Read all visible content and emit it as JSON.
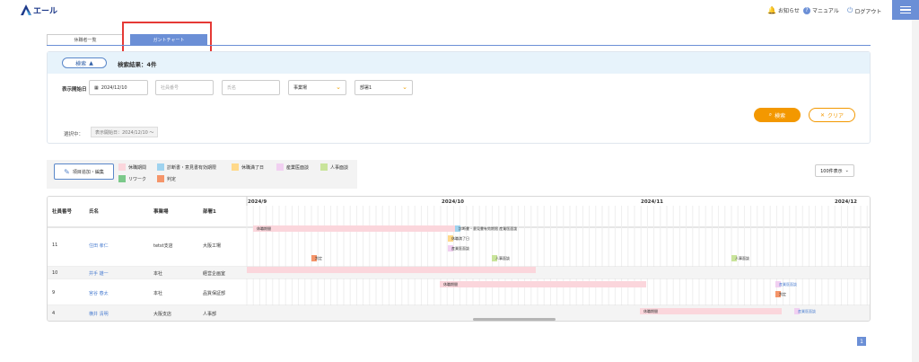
{
  "header": {
    "logo_text": "エール",
    "notice": "お知らせ",
    "manual": "マニュアル",
    "logout": "ログアウト"
  },
  "tabs": [
    {
      "label": "休職者一覧"
    },
    {
      "label": "ガントチャート"
    }
  ],
  "search": {
    "toggle": "検索",
    "result": "検索結果：4件",
    "start_label": "表示開始日",
    "start_date": "2024/12/10",
    "emp_no_ph": "社員番号",
    "name_ph": "氏名",
    "site": "事業場",
    "dept": "部署1",
    "selected_label": "選択中：",
    "selected_chip": "表示開始日：2024/12/10 〜",
    "search_btn": "検索",
    "clear_btn": "クリア"
  },
  "legend": {
    "edit": "項目追加・編集",
    "items": [
      "休職期間",
      "診断書・意見書有効期限",
      "休職満了日",
      "産業医面談",
      "人事面談",
      "リワーク",
      "判定"
    ],
    "colors": [
      "#fbd6dc",
      "#9fd3ef",
      "#ffd98a",
      "#f1d0f1",
      "#c9e49b",
      "#7bc98a",
      "#f5956a"
    ]
  },
  "per_page": "100件表示",
  "table": {
    "headers": [
      "社員番号",
      "氏名",
      "事業場",
      "部署1"
    ],
    "rows": [
      {
        "no": "11",
        "name": "住田 孝仁",
        "site": "tetst支店",
        "dept": "大阪工場"
      },
      {
        "no": "10",
        "name": "井手 雄一",
        "site": "本社",
        "dept": "経営企画室"
      },
      {
        "no": "9",
        "name": "宮谷 春太",
        "site": "本社",
        "dept": "品質保証部"
      },
      {
        "no": "4",
        "name": "横井 清明",
        "site": "大阪支店",
        "dept": "人事部"
      }
    ]
  },
  "gantt": {
    "months": [
      "2024/9",
      "2024/10",
      "2024/11",
      "2024/12"
    ],
    "bars": {
      "b1": "休職期間",
      "b2": "診断書・意見書有効期限 産業医面談",
      "b3": "休職満了日",
      "b4": "産業医面談",
      "b5": "人事面談",
      "b6": "判定",
      "b7": "人事面談",
      "b8": "休職期間",
      "b9": "産業医面談",
      "b10": "判定",
      "b11": "休職期間",
      "b12": "産業医面談"
    }
  },
  "pager": "1"
}
